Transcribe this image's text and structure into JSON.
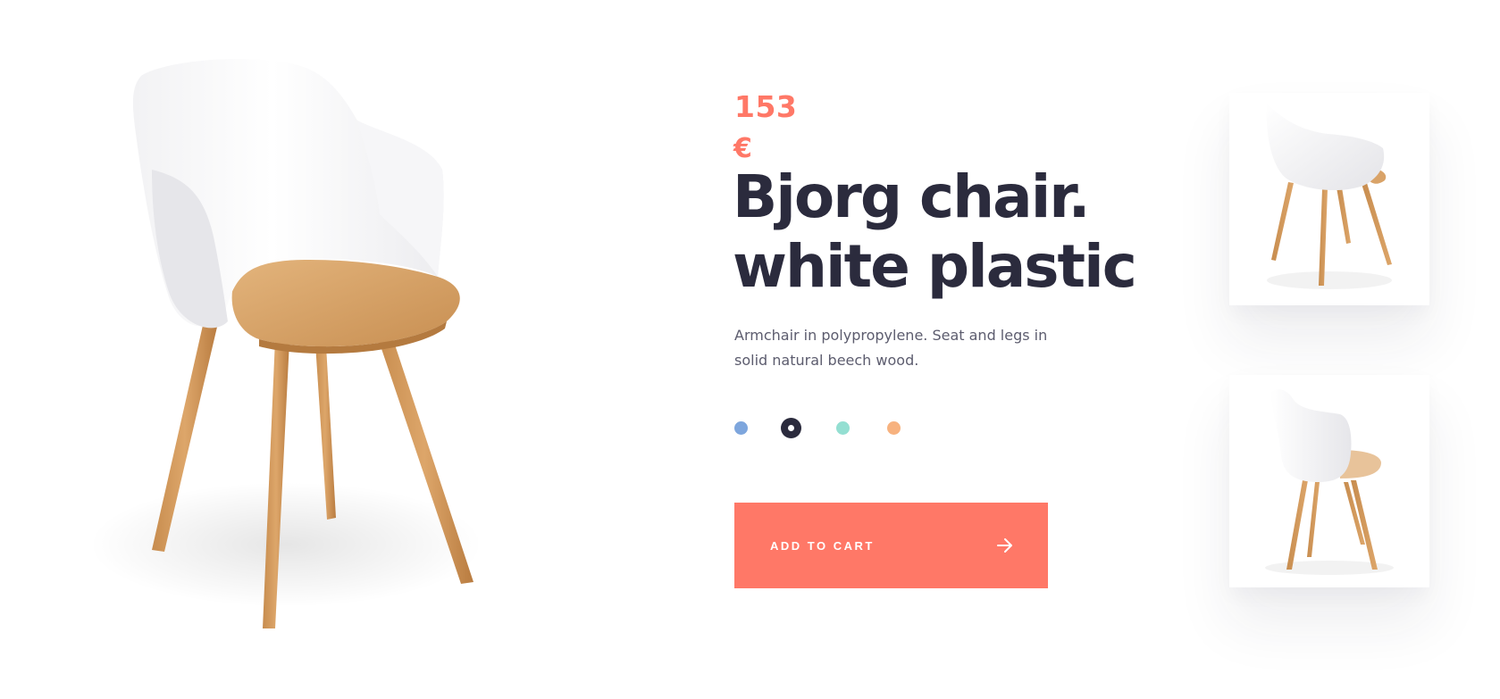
{
  "product": {
    "price_amount": "153",
    "price_currency": "€",
    "title_line1": "Bjorg chair.",
    "title_line2": "white plastic",
    "description": "Armchair in polypropylene. Seat and legs in solid natural beech wood."
  },
  "colors": {
    "accent": "#ff7867",
    "title": "#2b2b3d",
    "wood": "#d9a368",
    "swatches": [
      {
        "color": "#7ea6dd",
        "selected": false
      },
      {
        "color": "#2b2b3d",
        "selected": true
      },
      {
        "color": "#94dfd2",
        "selected": false
      },
      {
        "color": "#f7b27f",
        "selected": false
      }
    ]
  },
  "cart": {
    "label": "ADD TO CART",
    "icon": "arrow-right-icon"
  },
  "images": {
    "main": "chair-front-three-quarter",
    "thumbnails": [
      "chair-back-view",
      "chair-side-view"
    ]
  }
}
